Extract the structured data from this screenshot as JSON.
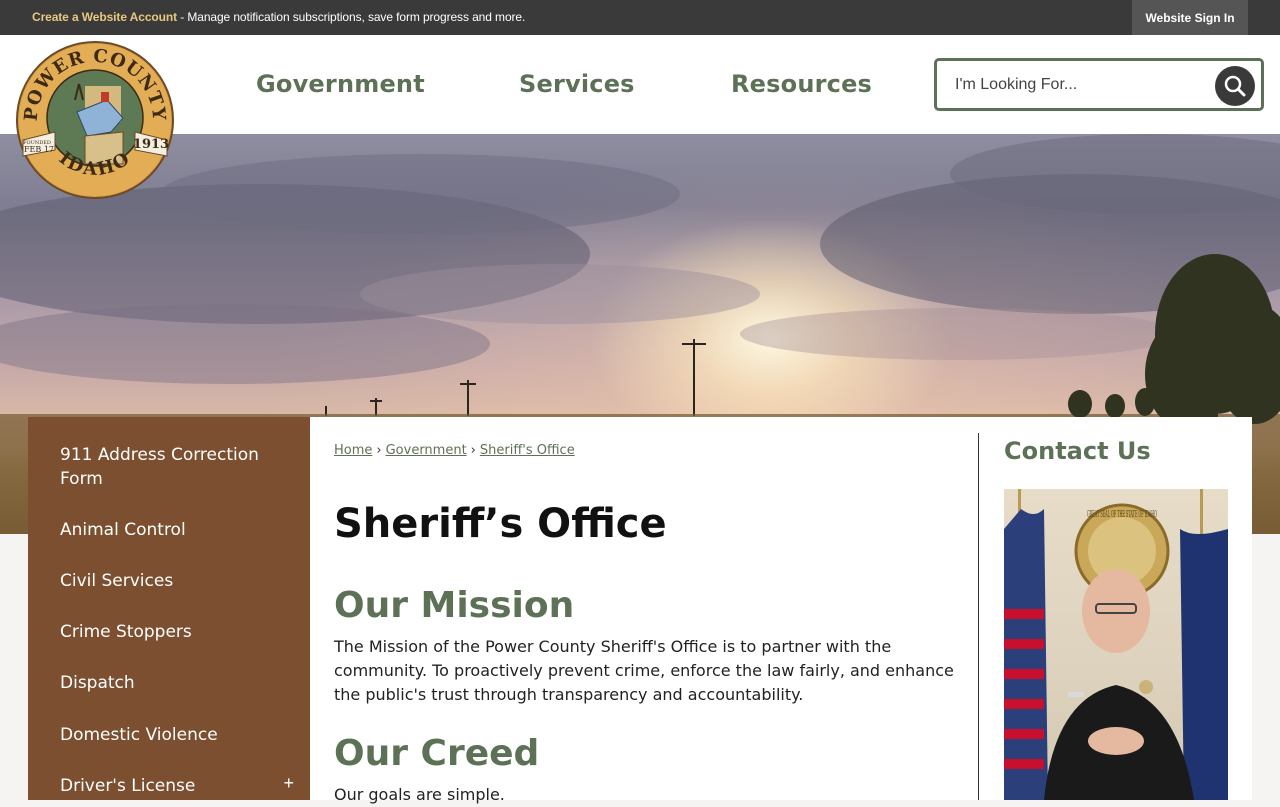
{
  "topbar": {
    "create_account": "Create a Website Account",
    "promo_text": " - Manage notification subscriptions, save form progress and more.",
    "sign_in": "Website Sign In"
  },
  "logo": {
    "arc_text": "POWER COUNTY",
    "bottom_text": "IDAHO",
    "founded": "FOUNDED",
    "founded_date": "FEB 17",
    "year": "1913"
  },
  "nav": {
    "government": "Government",
    "services": "Services",
    "resources": "Resources"
  },
  "search": {
    "placeholder": "I'm Looking For...",
    "icon": "search-icon"
  },
  "sidebar": {
    "items": [
      {
        "label": "911 Address Correction Form"
      },
      {
        "label": "Animal Control"
      },
      {
        "label": "Civil Services"
      },
      {
        "label": "Crime Stoppers"
      },
      {
        "label": "Dispatch"
      },
      {
        "label": "Domestic Violence"
      },
      {
        "label": "Driver's License"
      }
    ],
    "expand_symbol": "+"
  },
  "breadcrumb": {
    "home": "Home",
    "government": "Government",
    "current": "Sheriff's Office",
    "separator": "›"
  },
  "main": {
    "title": "Sheriff’s Office",
    "mission_heading": "Our Mission",
    "mission_text": "The Mission of the Power County Sheriff's Office is to partner with the community. To proactively prevent crime, enforce the law fairly, and enhance the public's trust through transparency and accountability.",
    "creed_heading": "Our Creed",
    "creed_text": "Our goals are simple."
  },
  "contact": {
    "title": "Contact Us",
    "seal_text": "GREAT SEAL OF THE STATE OF IDAHO"
  },
  "colors": {
    "accent_green": "#5d7156",
    "sidebar_brown": "#7b4f2f",
    "topbar_dark": "#3a3a3a",
    "link_gold": "#e8c77f"
  }
}
